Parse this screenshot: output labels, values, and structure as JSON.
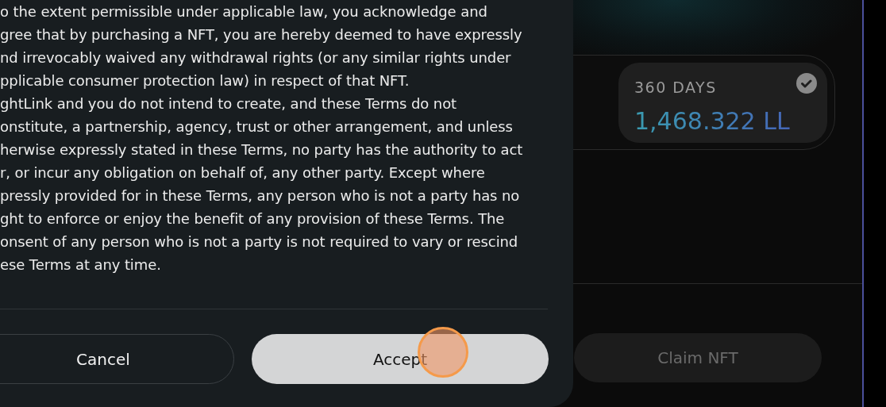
{
  "terms": {
    "lines": [
      "o the extent permissible under applicable law, you acknowledge and",
      "gree that by purchasing a NFT, you are hereby deemed to have expressly",
      "nd irrevocably waived any withdrawal rights (or any similar rights under",
      "pplicable consumer protection law) in respect of that NFT.",
      "ghtLink and you do not intend to create, and these Terms do not",
      "onstitute, a partnership, agency, trust or other arrangement, and unless",
      "herwise expressly stated in these Terms, no party has the authority to act",
      "r, or incur any obligation on behalf of, any other party. Except where",
      "pressly provided for in these Terms, any person who is not a party has no",
      "ght to enforce or enjoy the benefit of any provision of these Terms. The",
      "onsent of any person who is not a party is not required to vary or rescind",
      "ese Terms at any time."
    ]
  },
  "dialog_buttons": [
    {
      "label": "Cancel",
      "kind": "secondary"
    },
    {
      "label": "Accept",
      "kind": "primary"
    }
  ],
  "click_indicator": true,
  "plan": {
    "label": "360 DAYS",
    "amount": "1,468.322 LL",
    "selected": true
  },
  "claim_button": {
    "label": "Claim NFT",
    "disabled": true
  }
}
